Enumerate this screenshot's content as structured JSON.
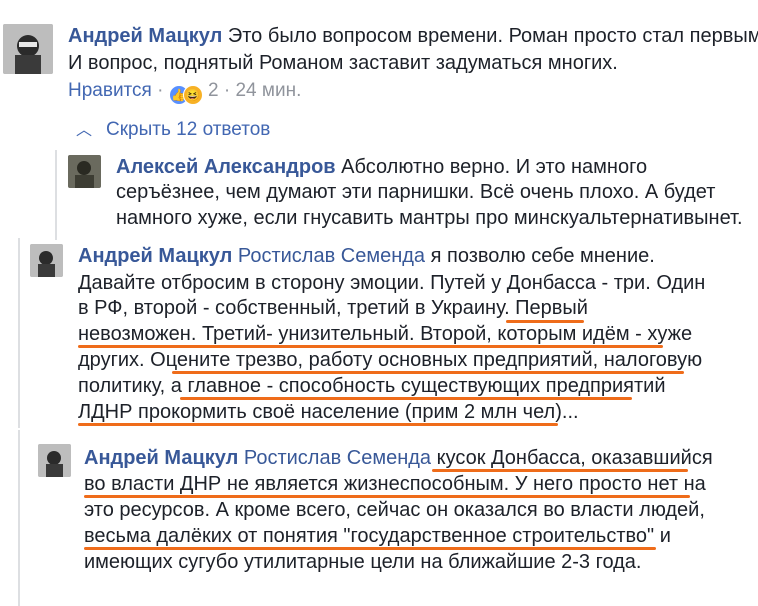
{
  "comment1": {
    "author": "Андрей Мацкул",
    "line1": " Это было вопросом времени. Роман просто стал первым.",
    "line2": "И вопрос, поднятый Романом заставит задуматься многих.",
    "like_label": "Нравится",
    "dot": " · ",
    "reaction_count": "2",
    "time": "24 мин."
  },
  "replies_toggle": {
    "label": "Скрыть 12 ответов",
    "icon": "chevron-up-icon"
  },
  "reply1": {
    "author": "Алексей Александров",
    "line1": " Абсолютно верно. И это намного",
    "line2": "серъёзнее, чем думают эти парнишки. Всё очень плохо. А будет",
    "line3": "намного хуже, если гнусавить мантры про минскуальтернативынет."
  },
  "reply2": {
    "author": "Андрей Мацкул",
    "mention": " Ростислав Семенда",
    "line1_rest": " я позволю себе мнение.",
    "line2": "Давайте отбросим в сторону эмоции. Путей у Донбасса - три. Один",
    "line3": "в РФ, второй - собственный, третий в Украину. Первый",
    "line4": "невозможен. Третий- унизительный. Второй, которым идём - хуже",
    "line5": "других. Оцените трезво, работу основных предприятий, налоговую",
    "line6": "политику, а главное - способность существующих предприятий",
    "line7": "ЛДНР прокормить своё население (прим 2 млн чел)..."
  },
  "reply3": {
    "author": "Андрей Мацкул",
    "mention": " Ростислав Семенда",
    "line1_rest": " кусок Донбасса, оказавшийся",
    "line2": "во власти ДНР не является жизнеспособным. У него просто нет на",
    "line3": "это ресурсов. А кроме всего, сейчас он оказался во власти людей,",
    "line4": "весьма далёких от понятия \"государственное строительство\" и",
    "line5": "имеющих сугубо утилитарные цели на ближайшие 2-3 года."
  },
  "colors": {
    "link": "#385898",
    "meta": "#90949c",
    "highlight": "#ef6c1a"
  }
}
